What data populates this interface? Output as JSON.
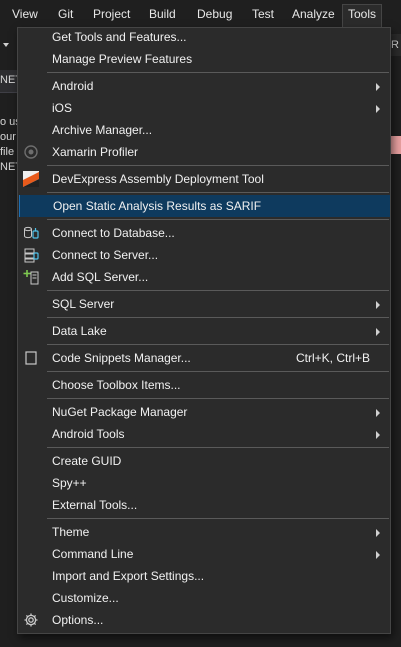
{
  "menubar": {
    "items": [
      "View",
      "Git",
      "Project",
      "Build",
      "Debug",
      "Test",
      "Analyze",
      "Tools"
    ]
  },
  "background": {
    "tab_fragment": "NET",
    "text_fragments": [
      "o us",
      "our",
      "file",
      "NET"
    ],
    "right_fragment": "tR"
  },
  "tools_menu": {
    "groups": [
      {
        "items": [
          {
            "label": "Get Tools and Features...",
            "icon": null
          },
          {
            "label": "Manage Preview Features",
            "icon": null
          }
        ]
      },
      {
        "items": [
          {
            "label": "Android",
            "submenu": true
          },
          {
            "label": "iOS",
            "submenu": true
          },
          {
            "label": "Archive Manager...",
            "icon": null
          },
          {
            "label": "Xamarin Profiler",
            "icon": "xamarin-profiler-icon"
          }
        ]
      },
      {
        "items": [
          {
            "label": "DevExpress Assembly Deployment Tool",
            "icon": "devexpress-icon"
          }
        ]
      },
      {
        "items": [
          {
            "label": "Open Static Analysis Results as SARIF",
            "highlighted": true
          }
        ]
      },
      {
        "items": [
          {
            "label": "Connect to Database...",
            "icon": "connect-database-icon"
          },
          {
            "label": "Connect to Server...",
            "icon": "connect-server-icon"
          },
          {
            "label": "Add SQL Server...",
            "icon": "add-sql-server-icon"
          }
        ]
      },
      {
        "items": [
          {
            "label": "SQL Server",
            "submenu": true
          }
        ]
      },
      {
        "items": [
          {
            "label": "Data Lake",
            "submenu": true
          }
        ]
      },
      {
        "items": [
          {
            "label": "Code Snippets Manager...",
            "shortcut": "Ctrl+K, Ctrl+B",
            "icon": "code-snippets-icon"
          }
        ]
      },
      {
        "items": [
          {
            "label": "Choose Toolbox Items..."
          }
        ]
      },
      {
        "items": [
          {
            "label": "NuGet Package Manager",
            "submenu": true
          },
          {
            "label": "Android Tools",
            "submenu": true
          }
        ]
      },
      {
        "items": [
          {
            "label": "Create GUID"
          },
          {
            "label": "Spy++"
          },
          {
            "label": "External Tools..."
          }
        ]
      },
      {
        "items": [
          {
            "label": "Theme",
            "submenu": true
          },
          {
            "label": "Command Line",
            "submenu": true
          },
          {
            "label": "Import and Export Settings..."
          },
          {
            "label": "Customize..."
          },
          {
            "label": "Options...",
            "icon": "gear-icon"
          }
        ]
      }
    ]
  }
}
